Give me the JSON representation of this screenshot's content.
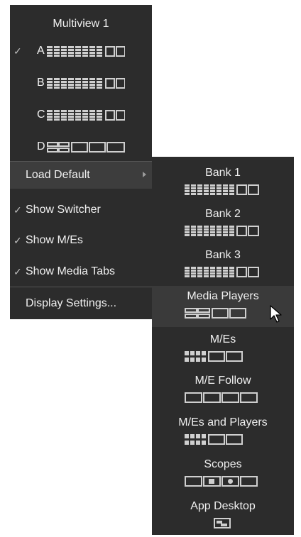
{
  "menu": {
    "title": "Multiview 1",
    "multiviews": [
      {
        "letter": "A",
        "checked": true,
        "layout": "multiview-layout-icon"
      },
      {
        "letter": "B",
        "checked": false,
        "layout": "multiview-layout-icon"
      },
      {
        "letter": "C",
        "checked": false,
        "layout": "multiview-layout-icon"
      },
      {
        "letter": "D",
        "checked": false,
        "layout": "quad-split-layout-icon"
      }
    ],
    "load_default": "Load Default",
    "show_switcher": "Show Switcher",
    "show_mes": "Show M/Es",
    "show_media_tabs": "Show Media Tabs",
    "display_settings": "Display Settings...",
    "check_mark": "✓"
  },
  "submenu": {
    "items": [
      {
        "label": "Bank 1",
        "icon": "bank-layout-icon"
      },
      {
        "label": "Bank 2",
        "icon": "bank-layout-icon"
      },
      {
        "label": "Bank 3",
        "icon": "bank-layout-icon"
      },
      {
        "label": "Media Players",
        "icon": "media-players-layout-icon"
      },
      {
        "label": "M/Es",
        "icon": "mes-layout-icon"
      },
      {
        "label": "M/E Follow",
        "icon": "me-follow-layout-icon"
      },
      {
        "label": "M/Es and Players",
        "icon": "mes-and-players-layout-icon"
      },
      {
        "label": "Scopes",
        "icon": "scopes-layout-icon"
      },
      {
        "label": "App Desktop",
        "icon": "app-desktop-layout-icon"
      }
    ]
  },
  "colors": {
    "menu_bg": "#2c2c2c",
    "highlight": "#3d3d3d",
    "text": "#f0f0f0",
    "icon_outline": "#cfcfcf"
  }
}
